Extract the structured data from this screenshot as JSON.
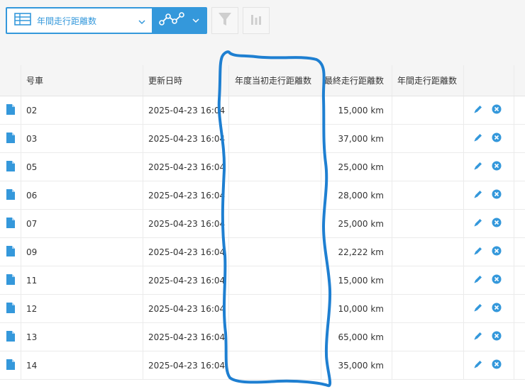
{
  "toolbar": {
    "view_name": "年間走行距離数",
    "view_icon": "table-icon",
    "graph_icon": "line-graph-icon",
    "filter_icon": "filter-icon",
    "chart_settings_icon": "bar-chart-icon"
  },
  "columns": {
    "number": "号車",
    "updated": "更新日時",
    "start_distance": "年度当初走行距離数",
    "final_distance": "最終走行距離数",
    "annual_distance": "年間走行距離数"
  },
  "rows": [
    {
      "number": "02",
      "updated": "2025-04-23 16:04",
      "final": "15,000 km"
    },
    {
      "number": "03",
      "updated": "2025-04-23 16:04",
      "final": "37,000 km"
    },
    {
      "number": "05",
      "updated": "2025-04-23 16:04",
      "final": "25,000 km"
    },
    {
      "number": "06",
      "updated": "2025-04-23 16:04",
      "final": "28,000 km"
    },
    {
      "number": "07",
      "updated": "2025-04-23 16:04",
      "final": "25,000 km"
    },
    {
      "number": "09",
      "updated": "2025-04-23 16:04",
      "final": "22,222 km"
    },
    {
      "number": "11",
      "updated": "2025-04-23 16:04",
      "final": "15,000 km"
    },
    {
      "number": "12",
      "updated": "2025-04-23 16:04",
      "final": "10,000 km"
    },
    {
      "number": "13",
      "updated": "2025-04-23 16:04",
      "final": "65,000 km"
    },
    {
      "number": "14",
      "updated": "2025-04-23 16:04",
      "final": "35,000 km"
    }
  ],
  "colors": {
    "accent": "#3498db",
    "annotation": "#1e7fd1",
    "edit": "#3498db",
    "delete": "#3498db"
  }
}
